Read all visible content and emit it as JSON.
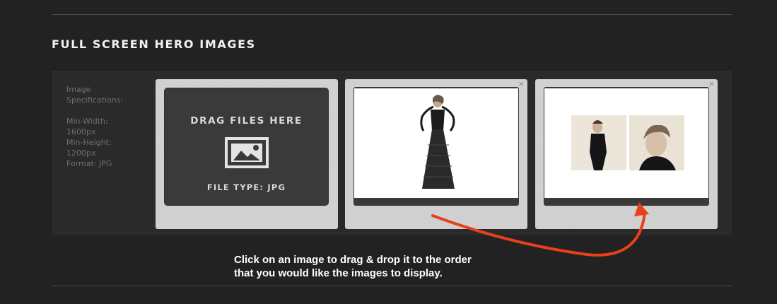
{
  "section": {
    "title": "FULL SCREEN HERO IMAGES"
  },
  "specs": {
    "lines_top": [
      "Image",
      "Specifications:"
    ],
    "lines_bottom": [
      "Min-Width:",
      "1600px",
      "Min-Height:",
      "1200px",
      "Format: JPG"
    ]
  },
  "dropzone": {
    "title": "DRAG FILES HERE",
    "icon": "image-icon",
    "file_type": "FILE TYPE: JPG"
  },
  "images": [
    {
      "name": "hero-image-1",
      "description_icon": "photo",
      "close_label": "×"
    },
    {
      "name": "hero-image-2",
      "description_icon": "photo",
      "close_label": "×"
    }
  ],
  "instructions": {
    "line1": "Click on an image to drag & drop it to the order",
    "line2": "that you would like the images to display."
  },
  "colors": {
    "background": "#222222",
    "card": "#cfcfcf",
    "arrow": "#e8401c",
    "text": "#ffffff"
  }
}
